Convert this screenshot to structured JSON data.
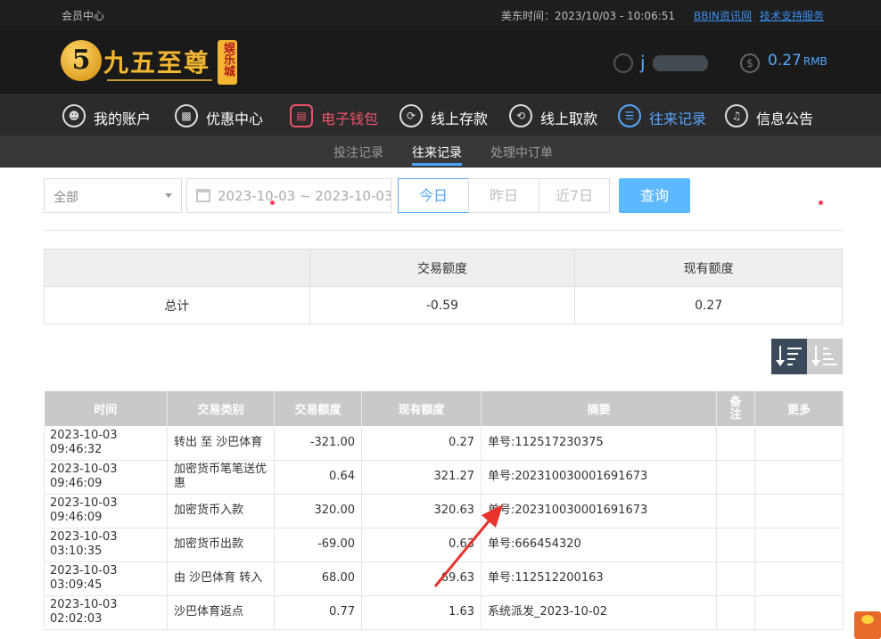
{
  "topbar": {
    "member_center": "会员中心",
    "time_label": "美东时间：2023/10/03 - 10:06:51",
    "link_news": "BBIN资讯网",
    "link_support": "技术支持服务"
  },
  "header": {
    "logo_text": "九五至尊",
    "logo_tag": "娱乐城",
    "username": "j",
    "balance": "0.27",
    "currency": "RMB"
  },
  "nav": {
    "items": [
      {
        "label": "我的账户",
        "icon": "user-icon"
      },
      {
        "label": "优惠中心",
        "icon": "gift-icon"
      },
      {
        "label": "电子钱包",
        "icon": "wallet-icon"
      },
      {
        "label": "线上存款",
        "icon": "deposit-icon"
      },
      {
        "label": "线上取款",
        "icon": "withdraw-icon"
      },
      {
        "label": "往来记录",
        "icon": "record-icon"
      },
      {
        "label": "信息公告",
        "icon": "bell-icon"
      }
    ]
  },
  "subnav": {
    "items": [
      "投注记录",
      "往来记录",
      "处理中订单"
    ]
  },
  "filters": {
    "type_selected": "全部",
    "date_range": "2023-10-03 ~ 2023-10-03",
    "today": "今日",
    "yesterday": "昨日",
    "last7": "近7日",
    "query": "查询"
  },
  "summary": {
    "headers": [
      "",
      "交易额度",
      "现有额度"
    ],
    "label": "总计",
    "trade_amount": "-0.59",
    "current_amount": "0.27"
  },
  "table": {
    "headers": [
      "时间",
      "交易类别",
      "交易额度",
      "现有额度",
      "摘要",
      "备注",
      "更多"
    ],
    "rows": [
      {
        "time": "2023-10-03 09:46:32",
        "type": "转出 至 沙巴体育",
        "amount": "-321.00",
        "balance": "0.27",
        "summary": "单号:112517230375"
      },
      {
        "time": "2023-10-03 09:46:09",
        "type": "加密货币笔笔送优惠",
        "amount": "0.64",
        "balance": "321.27",
        "summary": "单号:202310030001691673"
      },
      {
        "time": "2023-10-03 09:46:09",
        "type": "加密货币入款",
        "amount": "320.00",
        "balance": "320.63",
        "summary": "单号:202310030001691673"
      },
      {
        "time": "2023-10-03 03:10:35",
        "type": "加密货币出款",
        "amount": "-69.00",
        "balance": "0.63",
        "summary": "单号:666454320"
      },
      {
        "time": "2023-10-03 03:09:45",
        "type": "由 沙巴体育 转入",
        "amount": "68.00",
        "balance": "69.63",
        "summary": "单号:112512200163"
      },
      {
        "time": "2023-10-03 02:02:03",
        "type": "沙巴体育返点",
        "amount": "0.77",
        "balance": "1.63",
        "summary": "系统派发_2023-10-02"
      }
    ]
  }
}
